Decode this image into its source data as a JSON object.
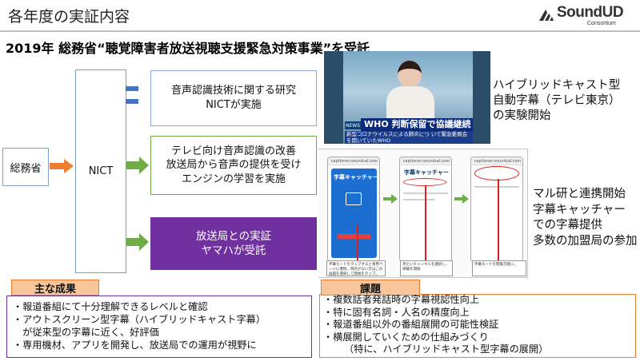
{
  "header": {
    "title": "各年度の実証内容",
    "logo_text": "SoundUD",
    "logo_sub": "Consortium"
  },
  "subtitle": "2019年 総務省“聴覚障害者放送視聴支援緊急対策事業”を受託",
  "flow": {
    "ministry": "総務省",
    "nict": "NICT",
    "tasks": [
      {
        "lines": [
          "音声認識技術に関する研究",
          "NICTが実施"
        ]
      },
      {
        "lines": [
          "テレビ向け音声認識の改善",
          "放送局から音声の提供を受け",
          "エンジンの学習を実施"
        ]
      },
      {
        "lines": [
          "放送局との実証",
          "ヤマハが受託"
        ]
      }
    ]
  },
  "tv": {
    "headline": "WHO 判断保留で協議継続",
    "caption": "新型コロナウイルスによる肺炎につ いて緊急委員会を開いていたWHO",
    "news_logo": "NEWS",
    "desc_lines": [
      "ハイブリッドキャスト型",
      "自動字幕（テレビ東京）",
      "の実験開始"
    ]
  },
  "phones": {
    "app_name": "字幕キャッチャー",
    "url": "captioner.soundud.com",
    "callouts": [
      "字幕モードをタップすると専用ページに遷移。目的がない方はこの画面を選択して開始をタップ。",
      "見たいチャンネルを選択し、視聴を開始",
      "字幕モードを閲覧可能に。"
    ],
    "desc_lines": [
      "マル研と連携開始",
      "字幕キャッチャー",
      "での字幕提供",
      "多数の加盟局の参加"
    ]
  },
  "results": {
    "label": "主な成果",
    "items": [
      "・報道番組にて十分理解できるレベルと確認",
      "・アウトスクリーン型字幕（ハイブリッドキャスト字幕）",
      "　が従来型の字幕に近く、好評価",
      "・専用機材、アプリを開発し、放送局での運用が視野に"
    ]
  },
  "issues": {
    "label": "課題",
    "items": [
      "・複数話者発話時の字幕視認性向上",
      "・特に固有名詞・人名の精度向上",
      "・報道番組以外の番組展開の可能性検証",
      "・横展開していくための仕組みづくり"
    ],
    "note": "（特に、ハイブリッドキャスト型字幕の展開）"
  },
  "colors": {
    "ministry_arrow": "#ed7d31",
    "task_arrow": "#70ad47",
    "accent_purple": "#7030a0",
    "accent_blue": "#4472c4"
  }
}
